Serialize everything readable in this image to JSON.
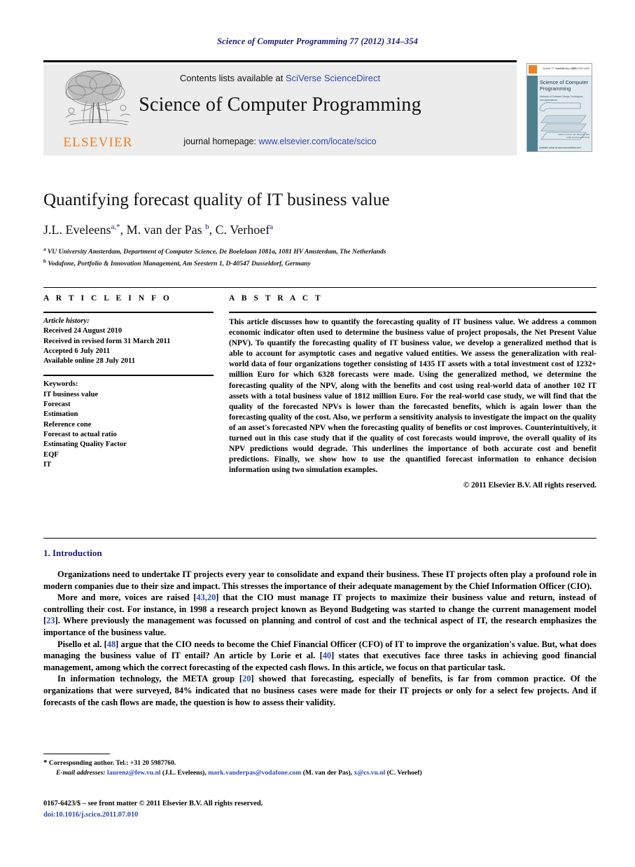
{
  "running_head": "Science of Computer Programming 77 (2012) 314–354",
  "masthead": {
    "contents_prefix": "Contents lists available at ",
    "sciencedirect_link": "SciVerse ScienceDirect",
    "journal_title": "Science of Computer Programming",
    "homepage_prefix": "journal homepage: ",
    "homepage_link": "www.elsevier.com/locate/scico",
    "background_color": "#ececec"
  },
  "publisher_logo": {
    "wordmark": "ELSEVIER",
    "color": "#f08020"
  },
  "cover": {
    "title": "Science of Computer Programming",
    "subtitle": "Methods of Software Design: Techniques and Applications",
    "top_left": "Volume 77, Issue 4",
    "top_mid": "1 February 2012",
    "top_right": "ISSN 0167-6423",
    "editor_note": "Editor-in-Chief: Jan Bergstra, Bas Luttik and Arend Rensink",
    "footer": "Available online at www.sciencedirect.com",
    "band_color": "#4f7f8c"
  },
  "article": {
    "title": "Quantifying forecast quality of IT business value",
    "authors": [
      {
        "name": "J.L. Eveleens",
        "marks": "a,*"
      },
      {
        "name": "M. van der Pas",
        "marks": "b"
      },
      {
        "name": "C. Verhoef",
        "marks": "a"
      }
    ],
    "affiliations": [
      {
        "mark": "a",
        "text": "VU University Amsterdam, Department of Computer Science, De Boelelaan 1081a, 1081 HV Amsterdam, The Netherlands"
      },
      {
        "mark": "b",
        "text": "Vodafone, Portfolio & Innovation Management, Am Seestern 1, D-40547 Dusseldorf, Germany"
      }
    ]
  },
  "article_info": {
    "heading": "A R T I C L E    I N F O",
    "history_label": "Article history:",
    "history": [
      "Received 24 August 2010",
      "Received in revised form 31 March 2011",
      "Accepted 6 July 2011",
      "Available online 28 July 2011"
    ],
    "keywords_label": "Keywords:",
    "keywords": [
      "IT business value",
      "Forecast",
      "Estimation",
      "Reference cone",
      "Forecast to actual ratio",
      "Estimating Quality Factor",
      "EQF",
      "IT"
    ]
  },
  "abstract": {
    "heading": "A B S T R A C T",
    "text": "This article discusses how to quantify the forecasting quality of IT business value. We address a common economic indicator often used to determine the business value of project proposals, the Net Present Value (NPV). To quantify the forecasting quality of IT business value, we develop a generalized method that is able to account for asymptotic cases and negative valued entities. We assess the generalization with real-world data of four organizations together consisting of 1435 IT assets with a total investment cost of 1232+ million Euro for which 6328 forecasts were made. Using the generalized method, we determine the forecasting quality of the NPV, along with the benefits and cost using real-world data of another 102 IT assets with a total business value of 1812 million Euro. For the real-world case study, we will find that the quality of the forecasted NPVs is lower than the forecasted benefits, which is again lower than the forecasting quality of the cost. Also, we perform a sensitivity analysis to investigate the impact on the quality of an asset's forecasted NPV when the forecasting quality of benefits or cost improves. Counterintuitively, it turned out in this case study that if the quality of cost forecasts would improve, the overall quality of its NPV predictions would degrade. This underlines the importance of both accurate cost and benefit predictions. Finally, we show how to use the quantified forecast information to enhance decision information using two simulation examples.",
    "copyright": "© 2011 Elsevier B.V. All rights reserved."
  },
  "introduction": {
    "number": "1.",
    "heading": "Introduction",
    "paragraphs": [
      {
        "parts": [
          {
            "t": "Organizations need to undertake IT projects every year to consolidate and expand their business. These IT projects often play a profound role in modern companies due to their size and impact. This stresses the importance of their adequate management by the Chief Information Officer (CIO)."
          }
        ]
      },
      {
        "parts": [
          {
            "t": "More and more, voices are raised ["
          },
          {
            "t": "43,20",
            "cite": true
          },
          {
            "t": "] that the CIO must manage IT projects to maximize their business value and return, instead of controlling their cost. For instance, in 1998 a research project known as Beyond Budgeting was started to change the current management model ["
          },
          {
            "t": "23",
            "cite": true
          },
          {
            "t": "]. Where previously the management was focussed on planning and control of cost and the technical aspect of IT, the research emphasizes the importance of the business value."
          }
        ]
      },
      {
        "parts": [
          {
            "t": "Pisello et al. ["
          },
          {
            "t": "48",
            "cite": true
          },
          {
            "t": "] argue that the CIO needs to become the Chief Financial Officer (CFO) of IT to improve the organization's value. But, what does managing the business value of IT entail? An article by Lorie et al. ["
          },
          {
            "t": "40",
            "cite": true
          },
          {
            "t": "] states that executives face three tasks in achieving good financial management, among which the correct forecasting of the expected cash flows. In this article, we focus on that particular task."
          }
        ]
      },
      {
        "parts": [
          {
            "t": "In information technology, the META group ["
          },
          {
            "t": "20",
            "cite": true
          },
          {
            "t": "] showed that forecasting, especially of benefits, is far from common practice. Of the organizations that were surveyed, 84% indicated that no business cases were made for their IT projects or only for a select few projects. And if forecasts of the cash flows are made, the question is how to assess their validity."
          }
        ]
      }
    ]
  },
  "footnotes": {
    "corresponding": "Corresponding author. Tel.: +31 20 5987760.",
    "email_label": "E-mail addresses:",
    "emails": [
      {
        "address": "laurenz@few.vu.nl",
        "owner": "(J.L. Eveleens)"
      },
      {
        "address": "mark.vanderpas@vodafone.com",
        "owner": "(M. van der Pas)"
      },
      {
        "address": "x@cs.vu.nl",
        "owner": "(C. Verhoef)"
      }
    ]
  },
  "footer": {
    "front_matter": "0167-6423/$ – see front matter © 2011 Elsevier B.V. All rights reserved.",
    "doi": "doi:10.1016/j.scico.2011.07.010"
  }
}
